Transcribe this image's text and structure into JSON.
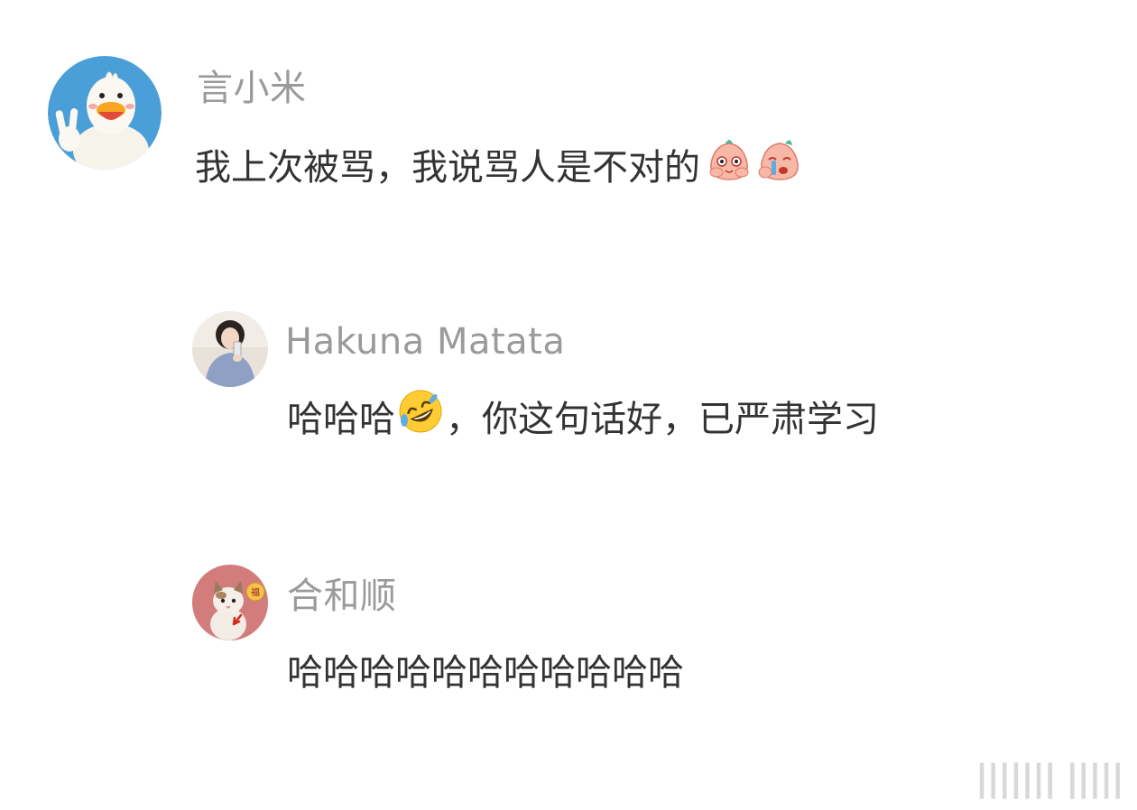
{
  "comments": [
    {
      "username": "言小米",
      "text": "我上次被骂，我说骂人是不对的",
      "emojis": [
        "smirk-peach-emoji",
        "crying-peach-emoji"
      ],
      "avatar": "duck-peace-sign-avatar"
    },
    {
      "username": "Hakuna Matata",
      "text_before": "哈哈哈",
      "text_after": "，你这句话好，已严肃学习",
      "emoji": "rolling-on-floor-laughing-emoji",
      "avatar": "girl-selfie-avatar"
    },
    {
      "username": "合和顺",
      "text": "哈哈哈哈哈哈哈哈哈哈哈",
      "avatar": "cat-photo-avatar"
    }
  ],
  "colors": {
    "username": "#9a9a9a",
    "body_text": "#333333",
    "background": "#ffffff"
  },
  "watermark": "||||||| |||||"
}
